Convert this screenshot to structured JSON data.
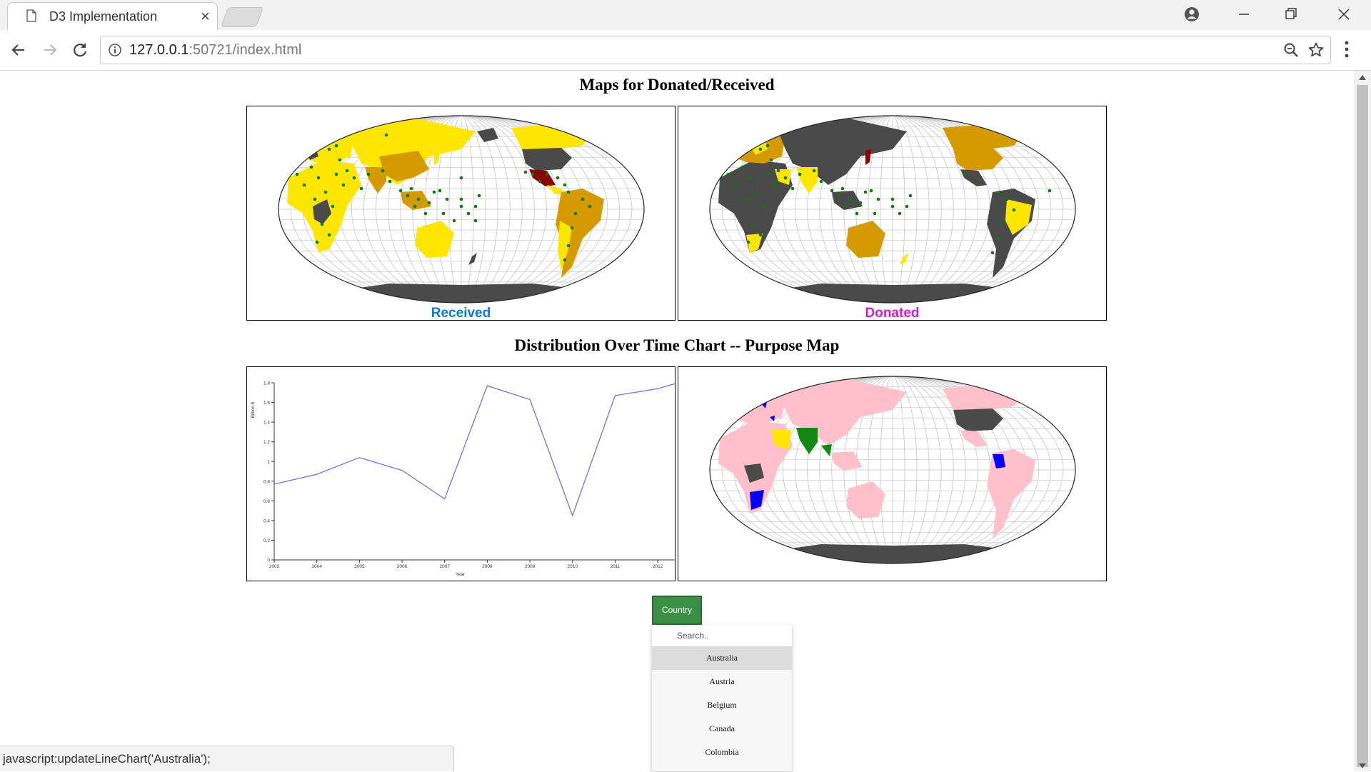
{
  "browser": {
    "tab_title": "D3 Implementation",
    "tab_close": "×",
    "url_host": "127.0.0.1",
    "url_rest": ":50721/index.html"
  },
  "page": {
    "section1_title": "Maps for Donated/Received",
    "section2_title": "Distribution Over Time Chart -- Purpose Map",
    "received_label": "Received",
    "donated_label": "Donated",
    "colors": {
      "received_label": "#0a7ad6",
      "donated_label": "#d21ad8",
      "dot": "#0a7c0a",
      "land_gray": "#4a4a4a",
      "yellow": "#ffe600",
      "orange": "#d49a00",
      "darkred": "#8b0000",
      "pink": "#ffc0cb",
      "green": "#118811",
      "blue": "#0000ff",
      "line": "#6666ee",
      "country_button": "#3c8f46"
    }
  },
  "chart_data": {
    "type": "line",
    "title": "",
    "xlabel": "Year",
    "ylabel": "Billion $",
    "x": [
      2003,
      2004,
      2005,
      2006,
      2007,
      2008,
      2009,
      2010,
      2011,
      2012,
      2012.4
    ],
    "values": [
      0.77,
      0.87,
      1.04,
      0.91,
      0.62,
      1.77,
      1.63,
      0.45,
      1.67,
      1.74,
      1.79
    ],
    "xticks": [
      "2003",
      "2004",
      "2005",
      "2006",
      "2007",
      "2008",
      "2009",
      "2010",
      "2011",
      "2012"
    ],
    "yticks": [
      "0",
      "0.2",
      "0.4",
      "0.6",
      "0.8",
      "1",
      "1.2",
      "1.4",
      "1.6",
      "1.8"
    ],
    "ylim": [
      0,
      1.8
    ],
    "xlim": [
      2003,
      2012.4
    ]
  },
  "selector": {
    "button_label": "Country",
    "search_placeholder": "Search..",
    "options": [
      "Australia",
      "Austria",
      "Belgium",
      "Canada",
      "Colombia"
    ],
    "active_option": "Australia"
  },
  "status_bar": "javascript:updateLineChart('Australia');"
}
